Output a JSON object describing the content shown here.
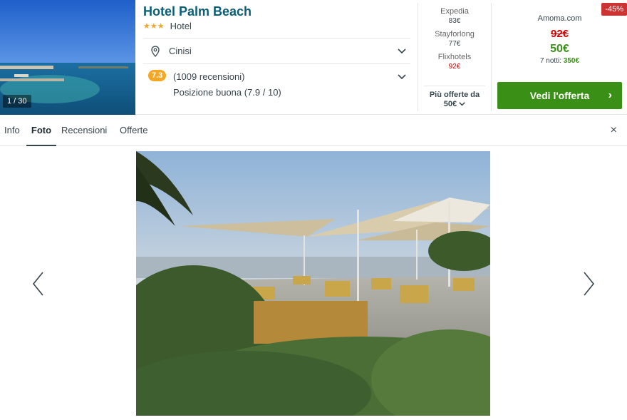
{
  "hotel": {
    "name": "Hotel Palm Beach",
    "stars": "★★★",
    "category": "Hotel",
    "location": "Cinisi",
    "rating_score": "7.3",
    "reviews": "(1009 recensioni)",
    "position_text": "Posizione buona (7.9 / 10)",
    "photo_counter": "1 / 30"
  },
  "offers": [
    {
      "provider": "Expedia",
      "price": "83€",
      "highlight": false
    },
    {
      "provider": "Stayforlong",
      "price": "77€",
      "highlight": false
    },
    {
      "provider": "Flixhotels",
      "price": "92€",
      "highlight": true
    }
  ],
  "more_offers": {
    "label": "Più offerte da",
    "price": "50€"
  },
  "best_offer": {
    "discount": "-45%",
    "provider": "Amoma.com",
    "old_price": "92€",
    "new_price": "50€",
    "nights_label": "7 notti:",
    "nights_total": "350€",
    "cta_label": "Vedi l'offerta",
    "cta_arrow": "›"
  },
  "tabs": [
    {
      "label": "Info",
      "active": false
    },
    {
      "label": "Foto",
      "active": true
    },
    {
      "label": "Recensioni",
      "active": false
    },
    {
      "label": "Offerte",
      "active": false
    }
  ],
  "close_label": "×",
  "colors": {
    "title": "#0a5e75",
    "star": "#f5a623",
    "cta": "#3a8f16",
    "discount": "#cc3333",
    "old_price": "#cc0000"
  },
  "gallery": {
    "current_index": 1,
    "total": 30
  }
}
